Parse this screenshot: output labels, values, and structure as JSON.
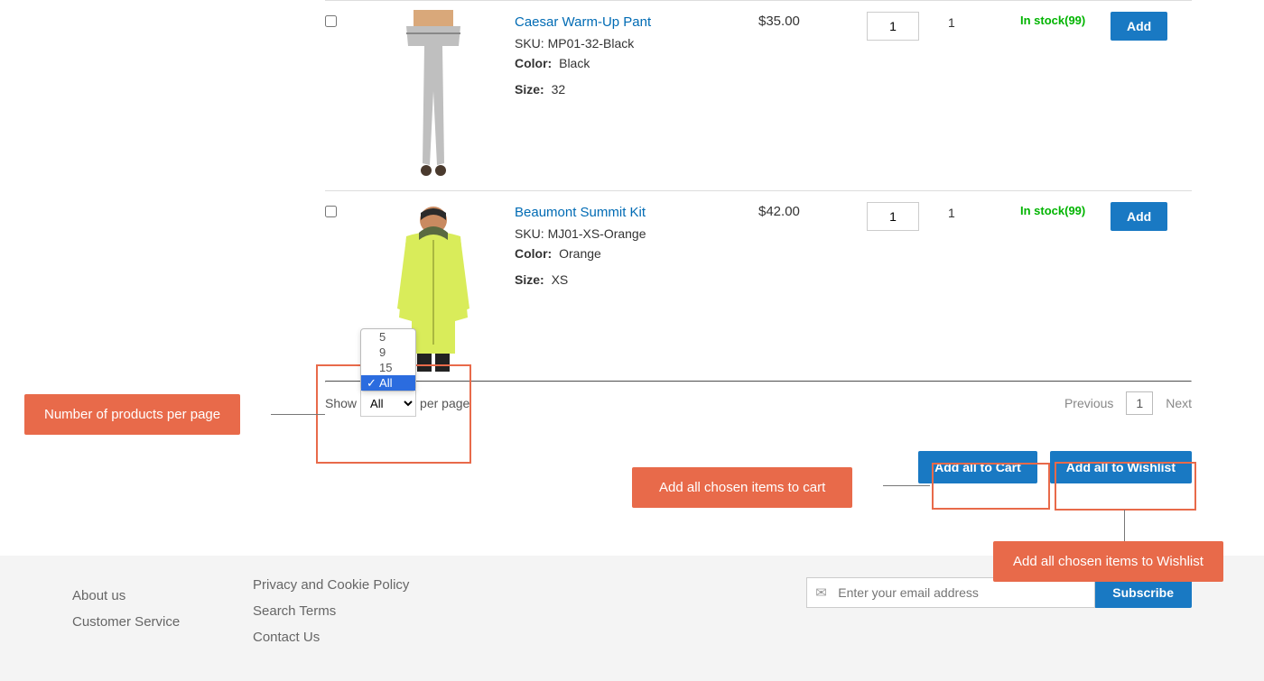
{
  "products": [
    {
      "name": "Caesar Warm-Up Pant",
      "sku_label": "SKU:",
      "sku": "MP01-32-Black",
      "color_label": "Color:",
      "color": "Black",
      "size_label": "Size:",
      "size": "32",
      "price": "$35.00",
      "qty": "1",
      "min_qty": "1",
      "stock_status": "In stock(99)",
      "add_label": "Add"
    },
    {
      "name": "Beaumont Summit Kit",
      "sku_label": "SKU:",
      "sku": "MJ01-XS-Orange",
      "color_label": "Color:",
      "color": "Orange",
      "size_label": "Size:",
      "size": "XS",
      "price": "$42.00",
      "qty": "1",
      "min_qty": "1",
      "stock_status": "In stock(99)",
      "add_label": "Add"
    }
  ],
  "toolbar": {
    "show_label": "Show",
    "per_page_label": "per page",
    "options": [
      "5",
      "9",
      "15",
      "All"
    ],
    "selected_option": "All",
    "prev_label": "Previous",
    "next_label": "Next",
    "current_page": "1"
  },
  "actions": {
    "add_all_cart": "Add all to Cart",
    "add_all_wishlist": "Add all to Wishlist"
  },
  "callouts": {
    "per_page": "Number of products per page",
    "cart": "Add all chosen items to cart",
    "wishlist": "Add all chosen items to Wishlist"
  },
  "footer": {
    "links_col1": [
      "About us",
      "Customer Service"
    ],
    "links_col2": [
      "Privacy and Cookie Policy",
      "Search Terms",
      "Contact Us"
    ],
    "email_placeholder": "Enter your email address",
    "subscribe_label": "Subscribe"
  }
}
